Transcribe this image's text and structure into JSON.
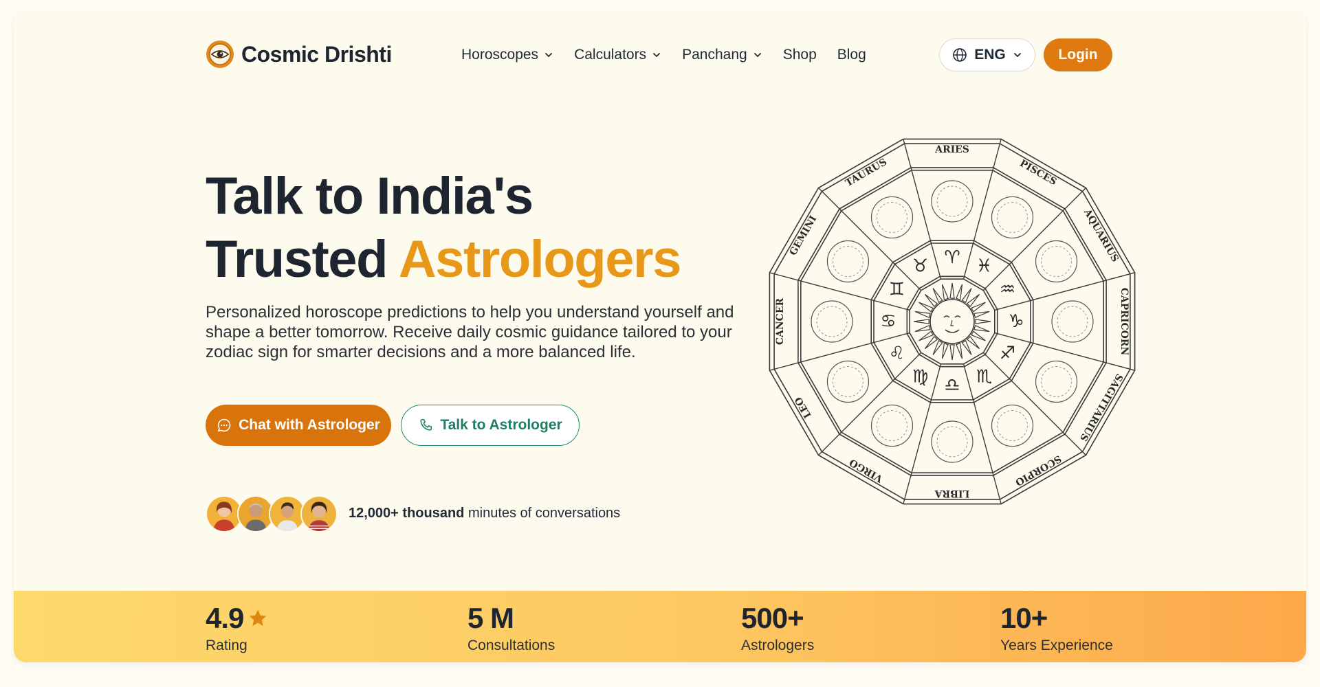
{
  "brand": {
    "name": "Cosmic Drishti"
  },
  "nav": {
    "items": [
      {
        "label": "Horoscopes",
        "dropdown": true
      },
      {
        "label": "Calculators",
        "dropdown": true
      },
      {
        "label": "Panchang",
        "dropdown": true
      },
      {
        "label": "Shop",
        "dropdown": false
      },
      {
        "label": "Blog",
        "dropdown": false
      }
    ],
    "language": "ENG",
    "login_label": "Login"
  },
  "hero": {
    "headline_line1": "Talk to India's",
    "headline_line2_plain": "Trusted ",
    "headline_line2_accent": "Astrologers",
    "subtext": "Personalized horoscope predictions to help you understand yourself and shape a better tomorrow. Receive daily cosmic guidance tailored to your zodiac sign for smarter decisions and a more balanced life.",
    "chat_button": "Chat with Astrologer",
    "talk_button": "Talk to Astrologer",
    "conversations_bold": "12,000+ thousand",
    "conversations_rest": " minutes of conversations"
  },
  "zodiac_wheel": {
    "signs": [
      "ARIES",
      "PISCES",
      "AQUARIUS",
      "CAPRICORN",
      "SAGITTARIUS",
      "SCORPIO",
      "LIBRA",
      "VIRGO",
      "LEO",
      "CANCER",
      "GEMINI",
      "TAURUS"
    ],
    "glyphs": [
      "♈",
      "♓",
      "♒",
      "♑",
      "♐",
      "♏",
      "♎",
      "♍",
      "♌",
      "♋",
      "♊",
      "♉"
    ]
  },
  "stats": [
    {
      "value": "4.9",
      "label": "Rating",
      "star": true
    },
    {
      "value": "5 M",
      "label": "Consultations",
      "star": false
    },
    {
      "value": "500+",
      "label": "Astrologers",
      "star": false
    },
    {
      "value": "10+",
      "label": "Years Experience",
      "star": false
    }
  ],
  "colors": {
    "accent_orange": "#d9740c",
    "headline_gold": "#e79818",
    "teal": "#1d7e66",
    "dark": "#1e2530"
  }
}
